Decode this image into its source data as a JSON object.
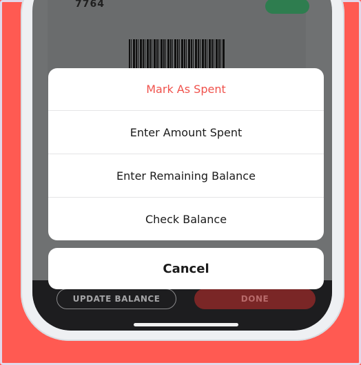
{
  "card": {
    "number_fragment": "7764",
    "badge_label": ""
  },
  "action_sheet": {
    "items": [
      {
        "label": "Mark As Spent",
        "style": "destructive"
      },
      {
        "label": "Enter Amount Spent",
        "style": "default"
      },
      {
        "label": "Enter Remaining Balance",
        "style": "default"
      },
      {
        "label": "Check Balance",
        "style": "default"
      }
    ],
    "cancel_label": "Cancel"
  },
  "bottom_bar": {
    "update_balance_label": "UPDATE BALANCE",
    "done_label": "DONE"
  },
  "colors": {
    "background": "#ff5a52",
    "destructive": "#f0524c",
    "done_button": "#7a2626"
  }
}
